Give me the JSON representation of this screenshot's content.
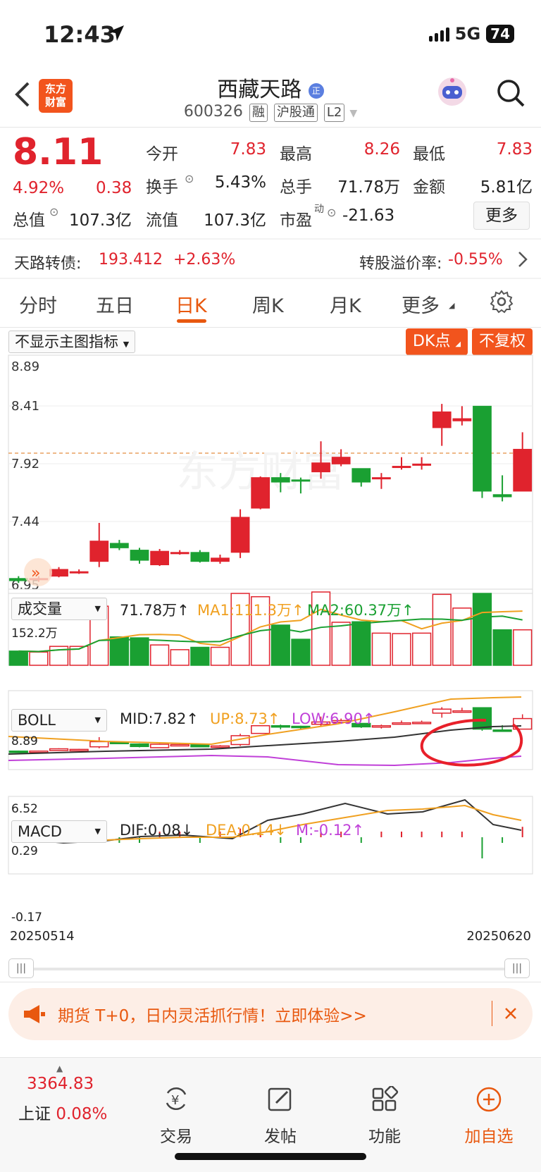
{
  "status_bar": {
    "time": "12:43",
    "network": "5G",
    "battery": "74"
  },
  "header": {
    "name": "西藏天路",
    "badge": "正",
    "code": "600326",
    "tags": [
      "融",
      "沪股通",
      "L2"
    ],
    "logo_line1": "东方",
    "logo_line2": "财富"
  },
  "quote": {
    "price": "8.11",
    "change_pct": "4.92%",
    "change": "0.38",
    "open_label": "今开",
    "open": "7.83",
    "high_label": "最高",
    "high": "8.26",
    "low_label": "最低",
    "low": "7.83",
    "turnover_label": "换手",
    "turnover": "5.43%",
    "volume_label": "总手",
    "volume": "71.78万",
    "amount_label": "金额",
    "amount": "5.81亿",
    "mktcap_label": "总值",
    "mktcap": "107.3亿",
    "float_label": "流值",
    "float_cap": "107.3亿",
    "pe_label": "市盈",
    "pe_sup": "动",
    "pe": "-21.63",
    "more": "更多"
  },
  "bond": {
    "name": "天路转债:",
    "price": "193.412",
    "change": "+2.63%",
    "premium_label": "转股溢价率:",
    "premium": "-0.55%"
  },
  "tabs": [
    "分时",
    "五日",
    "日K",
    "周K",
    "月K",
    "更多"
  ],
  "chart_toolbar": {
    "indicator_select": "不显示主图指标",
    "dk_button": "DK点",
    "adjust_button": "不复权"
  },
  "kline": {
    "y_labels": [
      "8.89",
      "8.41",
      "7.92",
      "7.44",
      "6.95"
    ]
  },
  "volume": {
    "select": "成交量",
    "value": "71.78万",
    "ma1": "MA1:111.3万",
    "ma2": "MA2:60.37万",
    "max_label": "152.2万"
  },
  "boll": {
    "select": "BOLL",
    "mid": "MID:7.82",
    "up": "UP:8.73",
    "low": "LOW:6.90",
    "y_top": "8.89",
    "y_bottom": "6.52"
  },
  "macd": {
    "select": "MACD",
    "dif": "DIF:0.08",
    "dea": "DEA:0.14",
    "m": "M:-0.12",
    "y_top": "0.29",
    "y_bottom": "-0.17"
  },
  "dates": {
    "start": "20250514",
    "end": "20250620"
  },
  "promo": {
    "text": "期货 T+0，日内灵活抓行情！立即体验>>"
  },
  "bottom_nav": {
    "index_value": "3364.83",
    "index_name": "上证",
    "index_change": "0.08%",
    "items": [
      "交易",
      "发帖",
      "功能",
      "加自选"
    ]
  },
  "chart_data": {
    "type": "candlestick",
    "candles": [
      {
        "o": 6.97,
        "c": 6.95,
        "h": 6.99,
        "l": 6.93
      },
      {
        "o": 6.96,
        "c": 6.97,
        "h": 6.99,
        "l": 6.94
      },
      {
        "o": 6.99,
        "c": 7.05,
        "h": 7.07,
        "l": 6.98
      },
      {
        "o": 7.03,
        "c": 7.03,
        "h": 7.05,
        "l": 7.01
      },
      {
        "o": 7.12,
        "c": 7.3,
        "h": 7.46,
        "l": 7.07
      },
      {
        "o": 7.28,
        "c": 7.24,
        "h": 7.31,
        "l": 7.22
      },
      {
        "o": 7.22,
        "c": 7.13,
        "h": 7.24,
        "l": 7.1
      },
      {
        "o": 7.09,
        "c": 7.21,
        "h": 7.23,
        "l": 7.08
      },
      {
        "o": 7.19,
        "c": 7.2,
        "h": 7.22,
        "l": 7.18
      },
      {
        "o": 7.2,
        "c": 7.12,
        "h": 7.22,
        "l": 7.11
      },
      {
        "o": 7.12,
        "c": 7.15,
        "h": 7.18,
        "l": 7.1
      },
      {
        "o": 7.2,
        "c": 7.51,
        "h": 7.58,
        "l": 7.15
      },
      {
        "o": 7.59,
        "c": 7.86,
        "h": 7.87,
        "l": 7.58
      },
      {
        "o": 7.86,
        "c": 7.82,
        "h": 7.9,
        "l": 7.73
      },
      {
        "o": 7.84,
        "c": 7.83,
        "h": 7.86,
        "l": 7.72
      },
      {
        "o": 7.91,
        "c": 7.99,
        "h": 8.18,
        "l": 7.85
      },
      {
        "o": 7.98,
        "c": 8.04,
        "h": 8.11,
        "l": 7.96
      },
      {
        "o": 7.94,
        "c": 7.82,
        "h": 7.94,
        "l": 7.78
      },
      {
        "o": 7.86,
        "c": 7.86,
        "h": 7.9,
        "l": 7.76
      },
      {
        "o": 7.95,
        "c": 7.96,
        "h": 8.04,
        "l": 7.93
      },
      {
        "o": 7.97,
        "c": 7.98,
        "h": 8.04,
        "l": 7.93
      },
      {
        "o": 8.3,
        "c": 8.44,
        "h": 8.51,
        "l": 8.14
      },
      {
        "o": 8.36,
        "c": 8.38,
        "h": 8.49,
        "l": 8.32
      },
      {
        "o": 8.49,
        "c": 7.74,
        "h": 8.49,
        "l": 7.68
      },
      {
        "o": 7.71,
        "c": 7.69,
        "h": 7.88,
        "l": 7.65
      },
      {
        "o": 7.74,
        "c": 8.11,
        "h": 8.26,
        "l": 7.74
      }
    ],
    "volumes": [
      30,
      28,
      40,
      40,
      125,
      60,
      58,
      43,
      33,
      38,
      38,
      152,
      145,
      85,
      55,
      155,
      91,
      92,
      68,
      67,
      68,
      150,
      121,
      152,
      75,
      75
    ],
    "ylim": [
      6.95,
      8.89
    ],
    "reference_price": 7.83
  }
}
